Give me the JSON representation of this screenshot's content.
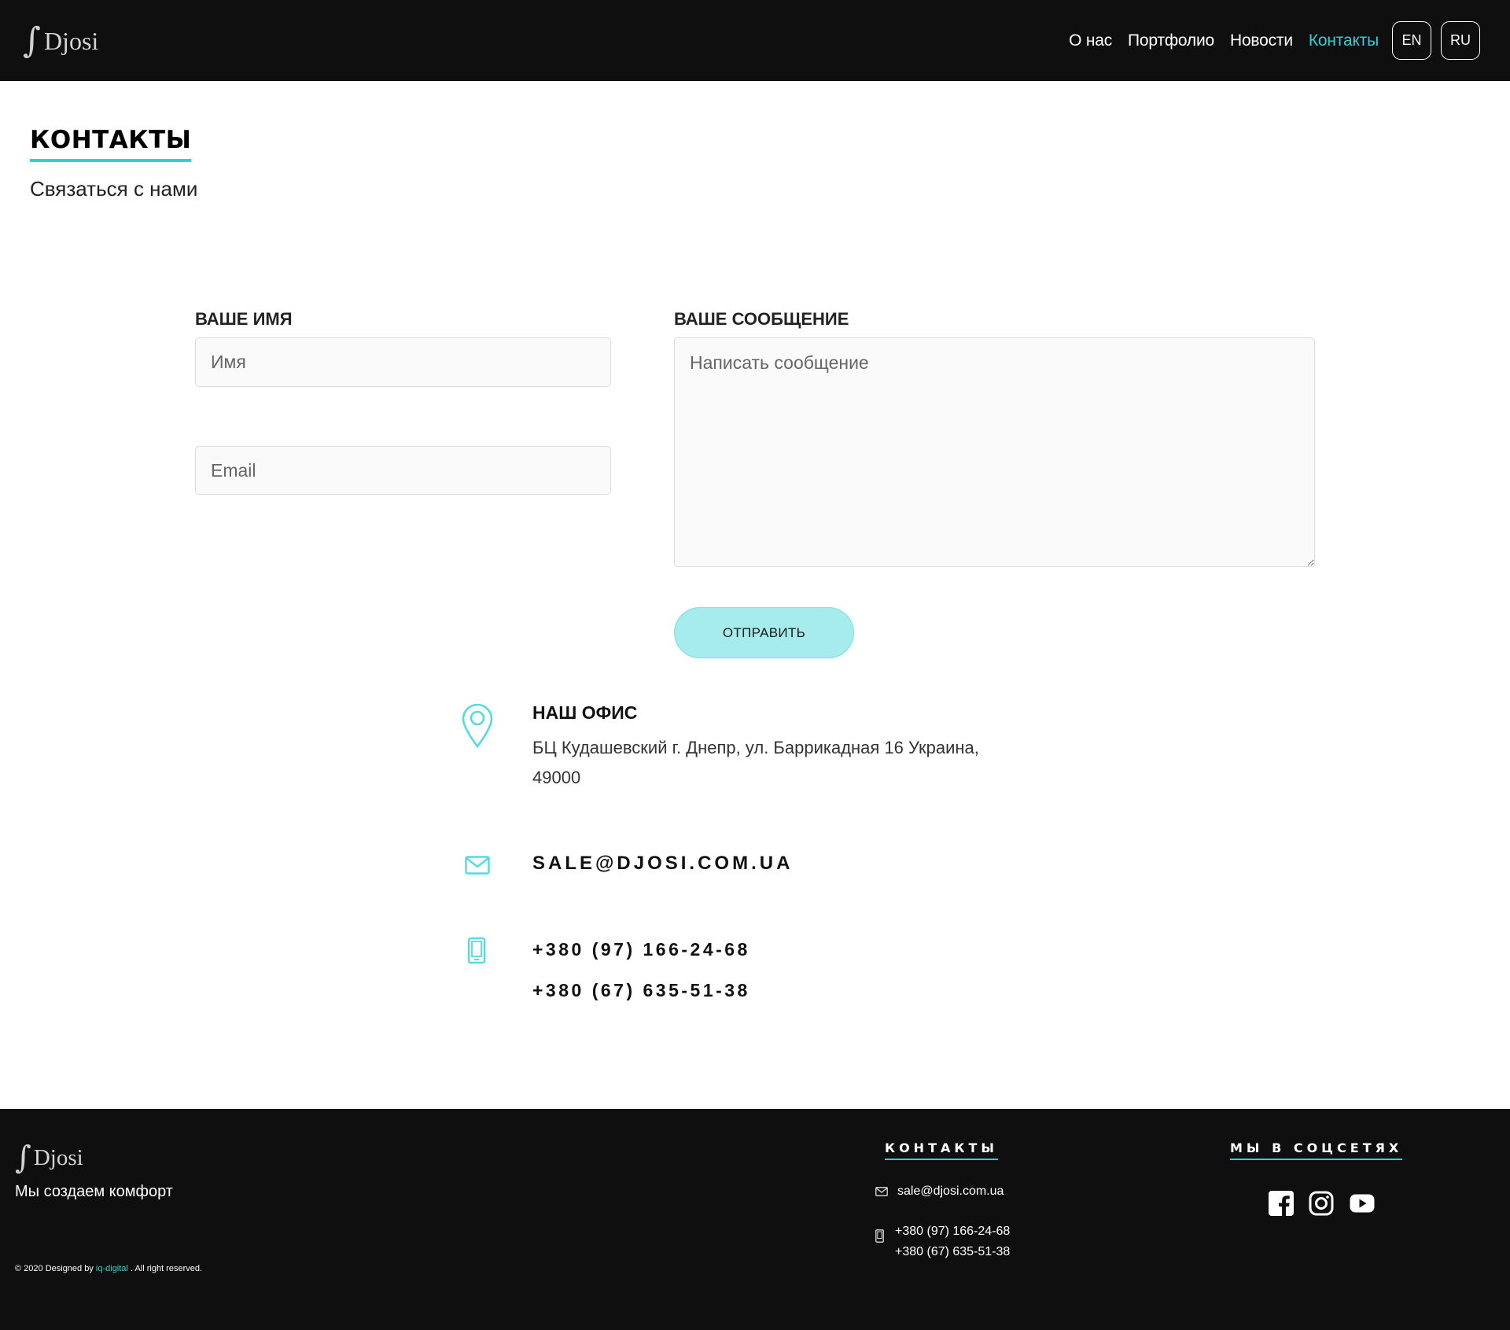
{
  "brand": {
    "logo_mark": "∫",
    "logo_word": "Djosi"
  },
  "nav": {
    "items": [
      {
        "label": "О нас",
        "active": false
      },
      {
        "label": "Портфолио",
        "active": false
      },
      {
        "label": "Новости",
        "active": false
      },
      {
        "label": "Контакты",
        "active": true
      }
    ],
    "languages": [
      "EN",
      "RU"
    ]
  },
  "page": {
    "title": "КОНТАКТЫ",
    "subtitle": "Связаться с нами"
  },
  "form": {
    "name_label": "ВАШЕ ИМЯ",
    "name_placeholder": "Имя",
    "email_placeholder": "Email",
    "message_label": "ВАШЕ СООБЩЕНИЕ",
    "message_placeholder": "Написать сообщение",
    "submit_label": "ОТПРАВИТЬ"
  },
  "contact_info": {
    "office_title": "НАШ ОФИС",
    "office_address": "БЦ Кудашевский г. Днепр, ул. Баррикадная 16 Украина, 49000",
    "email": "SALE@DJOSI.COM.UA",
    "phones": [
      "+380 (97) 166-24-68",
      "+380 (67) 635-51-38"
    ],
    "icons": [
      "location-pin-icon",
      "envelope-icon",
      "mobile-phone-icon"
    ]
  },
  "footer": {
    "tagline": "Мы создаем комфорт",
    "copyright_prefix": "© 2020 Designed by",
    "copyright_link": "iq-digital",
    "copyright_suffix": ". All right reserved.",
    "contacts_heading": "КОНТАКТЫ",
    "email": "sale@djosi.com.ua",
    "phones": [
      "+380 (97) 166-24-68",
      "+380 (67) 635-51-38"
    ],
    "social_heading": "МЫ В СОЦСЕТЯХ",
    "social_icons": [
      "facebook-icon",
      "instagram-icon",
      "youtube-icon"
    ]
  },
  "colors": {
    "accent": "#2fd1d6",
    "header_bg": "#0f0f0f",
    "button_bg": "#a6ecec"
  }
}
